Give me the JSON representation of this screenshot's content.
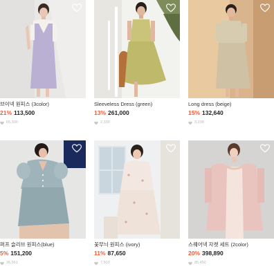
{
  "products": [
    {
      "title": "브이넥 원피스 (3color)",
      "discount": "21%",
      "price": "113,500",
      "likes": "65,300"
    },
    {
      "title": "Sleeveless Dress (green)",
      "discount": "13%",
      "price": "261,000",
      "likes": "2,330"
    },
    {
      "title": "Long dress (beige)",
      "discount": "15%",
      "price": "132,640",
      "likes": "3,238"
    },
    {
      "title": "퍼프 슬리브 원피스(blue)",
      "discount": "5%",
      "price": "151,200",
      "likes": "26,561"
    },
    {
      "title": "꽃무늬 원피스 (ivory)",
      "discount": "11%",
      "price": "87,650",
      "likes": "7,503"
    },
    {
      "title": "스퀘어넥 자켓 세트 (2color)",
      "discount": "20%",
      "price": "398,890",
      "likes": "85,450"
    }
  ],
  "colors": {
    "discount": "#f15a3a",
    "price": "#222222",
    "likes": "#b8b8b8",
    "heart_outline": "#ffffff"
  },
  "icons": {
    "wishlist": "heart-outline-icon",
    "likes": "heart-filled-icon"
  }
}
